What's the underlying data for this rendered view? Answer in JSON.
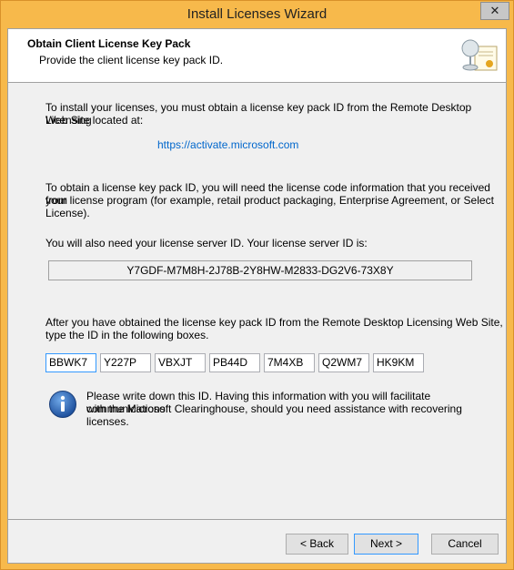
{
  "window": {
    "title": "Install Licenses Wizard",
    "close_glyph": "✕"
  },
  "header": {
    "title": "Obtain Client License Key Pack",
    "subtitle": "Provide the client license key pack ID.",
    "icon": "license-certificate-icon"
  },
  "body": {
    "intro_line1": "To install your licenses, you must obtain a license key pack ID from the Remote Desktop Licensing",
    "intro_line2": "Web Site located at:",
    "link": "https://activate.microsoft.com",
    "obtain_line1": "To obtain a license key pack ID, you will need the license code information that you received from",
    "obtain_line2": "your license program (for example, retail product packaging, Enterprise Agreement, or Select",
    "obtain_line3": "License).",
    "server_id_label": "You will also need your license server ID. Your license server ID is:",
    "server_id": "Y7GDF-M7M8H-2J78B-2Y8HW-M2833-DG2V6-73X8Y",
    "type_line1": "After you have obtained the license key pack ID from the Remote Desktop Licensing Web Site,",
    "type_line2": "type the ID in the following boxes.",
    "key_boxes": [
      "BBWK7",
      "Y227P",
      "VBXJT",
      "PB44D",
      "7M4XB",
      "Q2WM7",
      "HK9KM"
    ],
    "note_line1": "Please write down this ID. Having this information with you will facilitate communications",
    "note_line2": "with the Microsoft Clearinghouse, should you need assistance with recovering licenses."
  },
  "buttons": {
    "back": "< Back",
    "next": "Next >",
    "cancel": "Cancel"
  },
  "colors": {
    "title_bar": "#f7b94b",
    "link": "#0066cc",
    "focus": "#3399ff"
  }
}
